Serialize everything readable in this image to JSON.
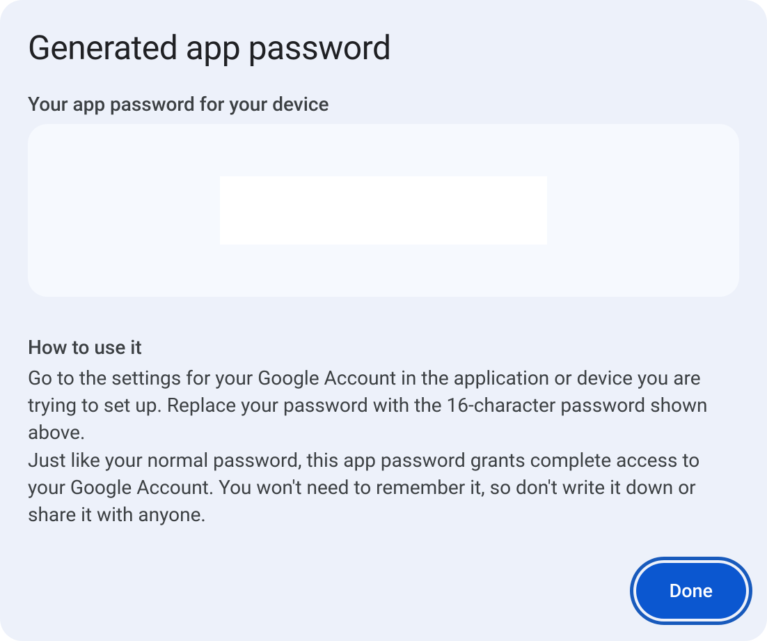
{
  "dialog": {
    "title": "Generated app password",
    "subtitle": "Your app password for your device",
    "password": "",
    "howToTitle": "How to use it",
    "description1": "Go to the settings for your Google Account in the application or device you are trying to set up. Replace your password with the 16-character password shown above.",
    "description2": "Just like your normal password, this app password grants complete access to your Google Account. You won't need to remember it, so don't write it down or share it with anyone.",
    "doneButton": "Done"
  }
}
